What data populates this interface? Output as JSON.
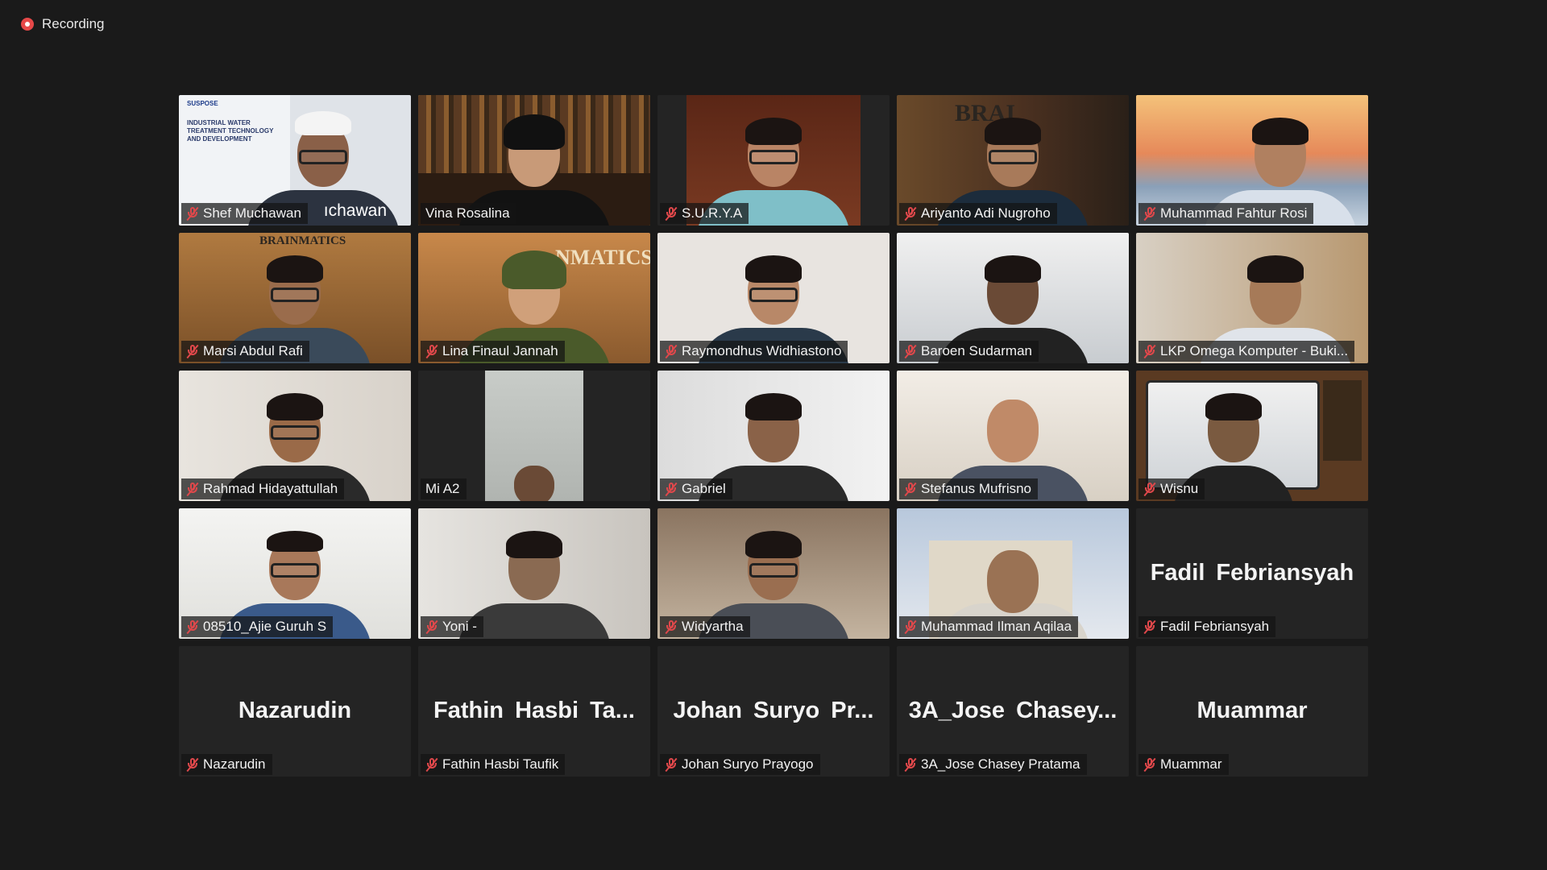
{
  "recording": {
    "label": "Recording"
  },
  "colors": {
    "speaking_border": "#cfe26a",
    "muted_mic": "#e0484b",
    "background": "#1a1a1a"
  },
  "tiles": [
    {
      "name": "Shef Muchawan",
      "video_overlay": "ıchawan",
      "slide": {
        "logo": "SUSPOSE",
        "text": "INDUSTRIAL WATER TREATMENT TECHNOLOGY AND DEVELOPMENT"
      },
      "muted": true
    },
    {
      "name": "Vina Rosalina",
      "muted": false,
      "speaking": true
    },
    {
      "name": "S.U.R.Y.A",
      "muted": true
    },
    {
      "name": "Ariyanto Adi Nugroho",
      "muted": true,
      "wall_sign": "BRAI"
    },
    {
      "name": "Muhammad Fahtur Rosi",
      "muted": true
    },
    {
      "name": "Marsi Abdul Rafi",
      "muted": true,
      "wall_sign": "BRAINMATICS"
    },
    {
      "name": "Lina Finaul Jannah",
      "muted": true,
      "wall_sign": "NMATICS"
    },
    {
      "name": "Raymondhus Widhiastono",
      "muted": true
    },
    {
      "name": "Baroen Sudarman",
      "muted": true
    },
    {
      "name": "LKP Omega Komputer - Buki...",
      "muted": true
    },
    {
      "name": "Rahmad Hidayattullah",
      "muted": true
    },
    {
      "name": "Mi A2",
      "muted": false
    },
    {
      "name": "Gabriel",
      "muted": true
    },
    {
      "name": "Stefanus Mufrisno",
      "muted": true
    },
    {
      "name": "Wisnu",
      "muted": true
    },
    {
      "name": "08510_Ajie Guruh S",
      "muted": true
    },
    {
      "name": "Yoni -",
      "muted": true
    },
    {
      "name": "Widyartha",
      "muted": true
    },
    {
      "name": "Muhammad Ilman Aqilaa",
      "muted": true
    },
    {
      "name": "Fadil Febriansyah",
      "display_name": "Fadil Febriansyah",
      "muted": true
    },
    {
      "name": "Nazarudin",
      "display_name": "Nazarudin",
      "muted": true
    },
    {
      "name": "Fathin Hasbi Taufik",
      "display_name": "Fathin Hasbi Ta...",
      "muted": true
    },
    {
      "name": "Johan Suryo Prayogo",
      "display_name": "Johan Suryo Pr...",
      "muted": true
    },
    {
      "name": "3A_Jose Chasey Pratama",
      "display_name": "3A_Jose Chasey...",
      "muted": true
    },
    {
      "name": "Muammar",
      "display_name": "Muammar",
      "muted": true
    }
  ]
}
